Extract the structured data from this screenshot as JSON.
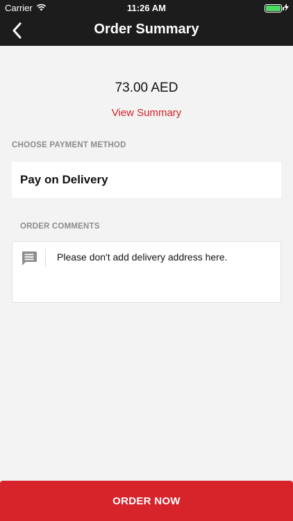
{
  "status_bar": {
    "carrier": "Carrier",
    "time": "11:26 AM",
    "battery_level": 1.0
  },
  "nav": {
    "title": "Order Summary",
    "back_icon": "chevron-left-icon"
  },
  "summary": {
    "amount": "73.00 AED",
    "view_summary_label": "View Summary"
  },
  "payment": {
    "section_label": "CHOOSE PAYMENT METHOD",
    "selected_method": "Pay on Delivery"
  },
  "comments": {
    "section_label": "ORDER COMMENTS",
    "placeholder": "Please don't add delivery address here.",
    "icon": "comment-icon"
  },
  "actions": {
    "order_now_label": "ORDER NOW"
  },
  "colors": {
    "accent": "#d7232a",
    "header_bg": "#1c1c1c",
    "page_bg": "#f3f3f3",
    "battery": "#4cd964"
  }
}
